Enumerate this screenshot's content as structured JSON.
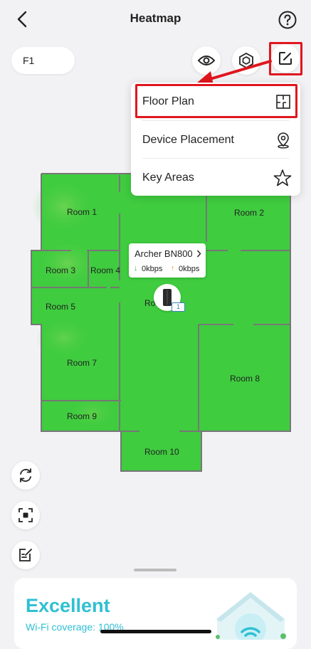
{
  "header": {
    "title": "Heatmap"
  },
  "floor_selector": {
    "label": "F1"
  },
  "toolbar": {
    "icons": [
      "eye-icon",
      "device-hexagon-icon",
      "edit-icon"
    ],
    "highlight_color": "#e0161e"
  },
  "menu": {
    "items": [
      {
        "label": "Floor Plan",
        "icon": "floor-plan-icon"
      },
      {
        "label": "Device Placement",
        "icon": "location-pin-icon"
      },
      {
        "label": "Key Areas",
        "icon": "star-icon"
      }
    ]
  },
  "floor_plan": {
    "heat_color": "#3fcc3f",
    "rooms": [
      "Room 1",
      "Room 2",
      "Room 3",
      "Room 4",
      "Ro",
      "Room 5",
      "Room 7",
      "Room 8",
      "Room 9",
      "Room 10"
    ]
  },
  "device": {
    "name": "Archer BN800",
    "download": "0kbps",
    "upload": "0kbps",
    "badge": "1"
  },
  "left_tools": {
    "icons": [
      "refresh-icon",
      "focus-icon",
      "notes-icon"
    ]
  },
  "summary": {
    "rating": "Excellent",
    "coverage_label": "Wi-Fi coverage: ",
    "coverage_value": "100%",
    "accent_color": "#2fc0d3"
  }
}
